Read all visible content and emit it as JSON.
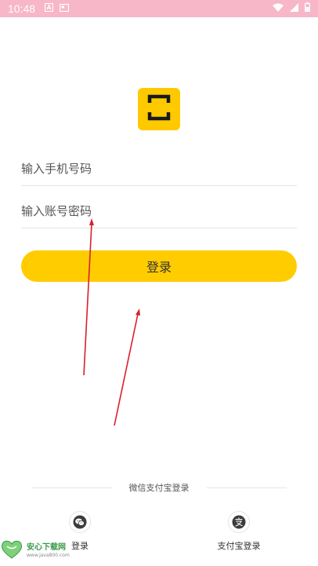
{
  "status_bar": {
    "time": "10:48"
  },
  "form": {
    "phone_placeholder": "输入手机号码",
    "password_placeholder": "输入账号密码",
    "login_label": "登录"
  },
  "alt_login": {
    "divider_text": "微信支付宝登录",
    "wechat_label": "登录",
    "alipay_label": "支付宝登录"
  },
  "watermark": {
    "title": "安心下载网",
    "url": "www.java800.com"
  },
  "colors": {
    "accent": "#ffcc00",
    "status_bar": "#f7b7c8",
    "annotation_arrow": "#d9202a"
  },
  "icons": {
    "logo": "scan-frame-icon",
    "wechat": "wechat-icon",
    "alipay": "alipay-icon"
  }
}
